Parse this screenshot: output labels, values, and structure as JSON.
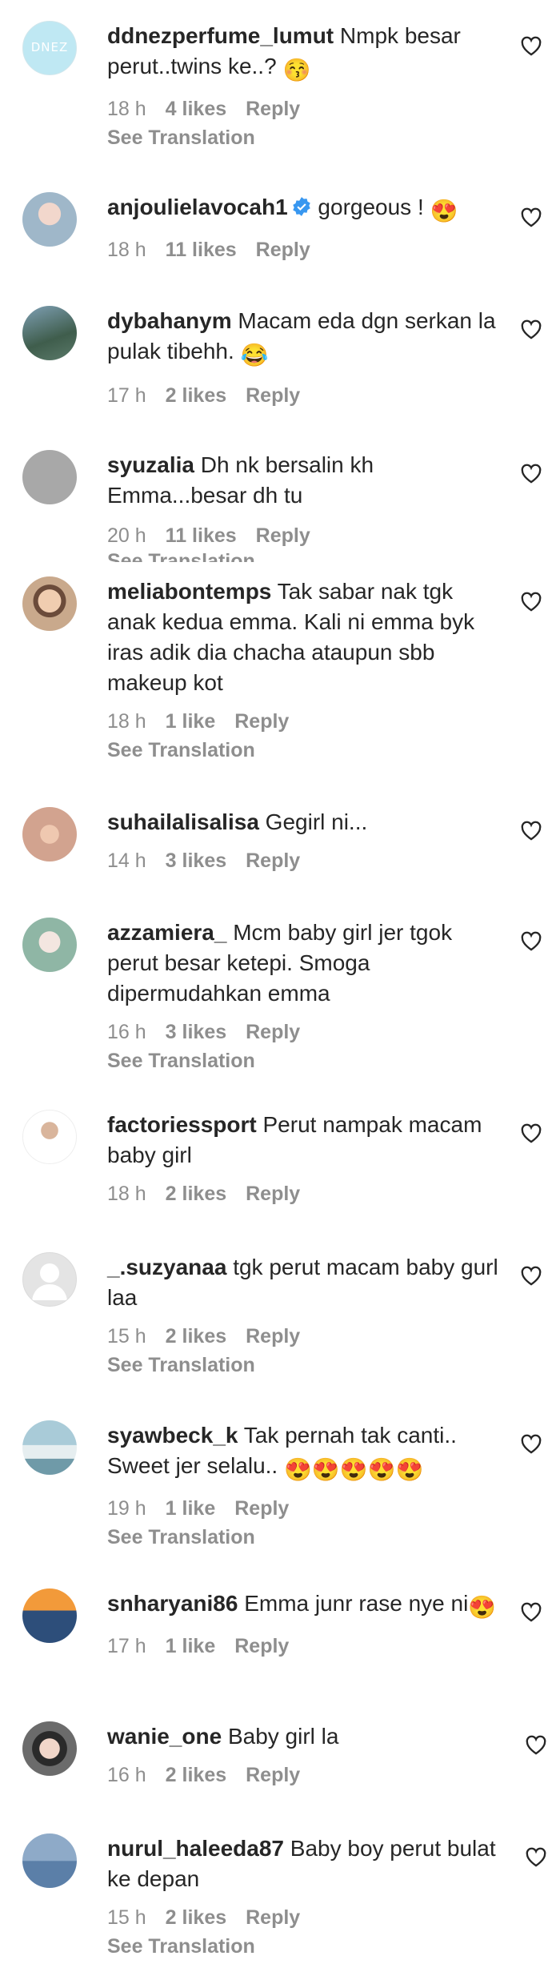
{
  "comments": [
    {
      "user": "ddnezperfume_lumut",
      "text": "Nmpk besar perut..twins ke..?",
      "emoji": "😚",
      "time": "18 h",
      "likes": "4 likes",
      "reply": "Reply",
      "translation": "See Translation",
      "avatar_label": "DNEZ",
      "avatar_color": "#bfe8f3"
    },
    {
      "user": "anjoulielavocah1",
      "text": "gorgeous !",
      "emoji": "😍",
      "time": "18 h",
      "likes": "11 likes",
      "reply": "Reply",
      "translation": "",
      "avatar_color": "#9fb7c9"
    },
    {
      "user": "dybahanym",
      "text": "Macam eda dgn serkan la pulak tibehh.",
      "emoji": "😂",
      "time": "17 h",
      "likes": "2 likes",
      "reply": "Reply",
      "translation": "",
      "avatar_color": "#5b7a6a"
    },
    {
      "user": "syuzalia",
      "text": "Dh nk bersalin kh Emma...besar dh tu",
      "emoji": "",
      "time": "20 h",
      "likes": "11 likes",
      "reply": "Reply",
      "translation": "See Translation",
      "avatar_color": "#a8a8a8"
    },
    {
      "user": "meliabontemps",
      "text": "Tak sabar nak tgk anak kedua emma. Kali ni emma byk iras adik dia chacha ataupun sbb makeup kot",
      "emoji": "",
      "time": "18 h",
      "likes": "1 like",
      "reply": "Reply",
      "translation": "See Translation",
      "avatar_color": "#c9a98c"
    },
    {
      "user": "suhailalisalisa",
      "text": "Gegirl ni...",
      "emoji": "",
      "time": "14 h",
      "likes": "3 likes",
      "reply": "Reply",
      "translation": "",
      "avatar_color": "#d2a38f"
    },
    {
      "user": "azzamiera_",
      "text": "Mcm baby girl jer tgok perut besar ketepi. Smoga dipermudahkan emma",
      "emoji": "",
      "time": "16 h",
      "likes": "3 likes",
      "reply": "Reply",
      "translation": "See Translation",
      "avatar_color": "#8fb6a5"
    },
    {
      "user": "factoriessport",
      "text": "Perut nampak macam baby girl",
      "emoji": "",
      "time": "18 h",
      "likes": "2 likes",
      "reply": "Reply",
      "translation": "",
      "avatar_color": "#e8e8e8"
    },
    {
      "user": "_.suzyanaa",
      "text": "tgk perut macam baby gurl laa",
      "emoji": "",
      "time": "15 h",
      "likes": "2 likes",
      "reply": "Reply",
      "translation": "See Translation",
      "avatar_color": "#dbdbdb"
    },
    {
      "user": "syawbeck_k",
      "text": "Tak pernah tak canti.. Sweet jer selalu..",
      "emoji": "😍😍😍😍😍",
      "time": "19 h",
      "likes": "1 like",
      "reply": "Reply",
      "translation": "See Translation",
      "avatar_color": "#6f9aa8"
    },
    {
      "user": "snharyani86",
      "text": "Emma junr rase nye ni",
      "emoji": "😍",
      "time": "17 h",
      "likes": "1 like",
      "reply": "Reply",
      "translation": "",
      "avatar_color": "#2d4e7a"
    },
    {
      "user": "wanie_one",
      "text": "Baby girl la",
      "emoji": "",
      "time": "16 h",
      "likes": "2 likes",
      "reply": "Reply",
      "translation": "",
      "avatar_color": "#6b6b6b"
    },
    {
      "user": "nurul_haleeda87",
      "text": "Baby boy perut bulat ke depan",
      "emoji": "",
      "time": "15 h",
      "likes": "2 likes",
      "reply": "Reply",
      "translation": "See Translation",
      "avatar_color": "#5b7fa8"
    }
  ],
  "icons": {
    "like": "heart-outline-icon",
    "verified": "verified-badge-icon"
  },
  "colors": {
    "text": "#262626",
    "meta": "#8e8e8e",
    "verified": "#3897f0"
  }
}
